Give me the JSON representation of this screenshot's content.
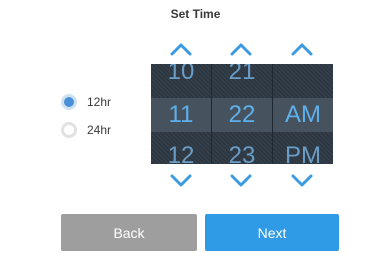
{
  "dialog": {
    "title": "Set Time"
  },
  "format": {
    "options": [
      {
        "label": "12hr",
        "selected": true
      },
      {
        "label": "24hr",
        "selected": false
      }
    ]
  },
  "picker": {
    "hour": {
      "prev": "10",
      "current": "11",
      "next": "12"
    },
    "minute": {
      "prev": "21",
      "current": "22",
      "next": "23"
    },
    "period": {
      "prev": "",
      "current": "AM",
      "next": "PM"
    }
  },
  "buttons": {
    "back_label": "Back",
    "next_label": "Next"
  },
  "colors": {
    "accent": "#2f9be6",
    "picker_bg": "#2f3a45",
    "picker_digit": "#5eb0ec",
    "back_button": "#9e9e9e",
    "arrow": "#3a9be0"
  },
  "icons": {
    "up": "chevron-up-icon",
    "down": "chevron-down-icon"
  }
}
